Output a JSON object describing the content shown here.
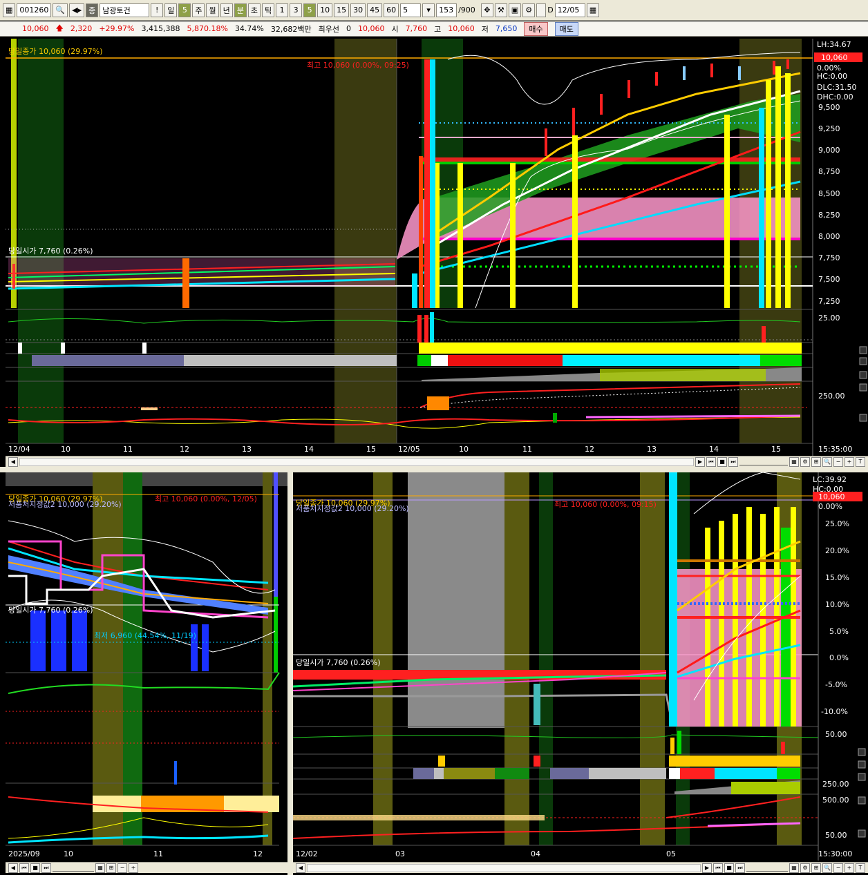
{
  "toolbar": {
    "code": "001260",
    "name": "남광토건",
    "name_badge": "종",
    "period_labels": [
      "일",
      "5",
      "주",
      "월",
      "년",
      "분",
      "초",
      "틱"
    ],
    "interval_labels": [
      "1",
      "3",
      "5",
      "10",
      "15",
      "30",
      "45",
      "60",
      "5"
    ],
    "count": "153",
    "count_total": "/900",
    "d_label": "D",
    "date": "12/05"
  },
  "infobar": {
    "price": "10,060",
    "change": "2,320",
    "change_pct": "+29.97%",
    "volume": "3,415,388",
    "volume_pct": "5,870.18%",
    "turnover_pct": "34.74%",
    "amount": "32,682백만",
    "best_label": "최우선",
    "best_value": "0",
    "best_price": "10,060",
    "open_label": "시",
    "open": "7,760",
    "high_label": "고",
    "high": "10,060",
    "low_label": "저",
    "low": "7,650",
    "buy_label": "매수",
    "sell_label": "매도"
  },
  "top_chart": {
    "close_label": "당일종가 10,060 (29.97%)",
    "high_label": "최고 10,060 (0.00%, 09:25)",
    "open_label": "당일시가 7,760 (0.26%)",
    "right_labels": [
      "LH:34.67",
      "10,060",
      "0.00%",
      "HC:0.00",
      "DLC:31.50",
      "DHC:0.00"
    ],
    "price_ticks": [
      "9,500",
      "9,250",
      "9,000",
      "8,750",
      "8,500",
      "8,250",
      "8,000",
      "7,750",
      "7,500",
      "7,250"
    ],
    "osc_tick": "25.00",
    "vol_tick": "250.00",
    "dates": [
      "12/04",
      "10",
      "11",
      "12",
      "13",
      "14",
      "15",
      "12/05",
      "10",
      "11",
      "12",
      "13",
      "14",
      "15"
    ],
    "time": "15:35:00"
  },
  "bottom_left_chart": {
    "close_label": "당일종가 10,060 (29.97%)",
    "high_label": "최고 10,060 (0.00%, 12/05)",
    "theory_label": "저품처지정값2 10,000 (29.20%)",
    "open_label": "당일시가 7,760 (0.26%)",
    "low_label": "최저 6,960 (44.54%, 11/19)",
    "dates": [
      "2025/09",
      "10",
      "11",
      "12"
    ]
  },
  "bottom_right_chart": {
    "close_label": "당일종가 10,060 (29.97%)",
    "theory_label": "저품처지정값2 10,000 (29.20%)",
    "high_label": "최고 10,060 (0.00%, 09:15)",
    "open_label": "당일시가 7,760 (0.26%)",
    "right_labels": [
      "LC:39.92",
      "HC:0.00",
      "10,060",
      "0.00%"
    ],
    "pct_ticks": [
      "25.0%",
      "20.0%",
      "15.0%",
      "10.0%",
      "5.0%",
      "0.0%",
      "-5.0%",
      "-10.0%"
    ],
    "osc_ticks": [
      "50.00",
      "250.00",
      "500.00",
      "50.00"
    ],
    "dates": [
      "12/02",
      "03",
      "04",
      "05"
    ],
    "time": "15:30:00"
  },
  "colors": {
    "up": "#e00000",
    "down": "#0030c0",
    "cyan": "#00e5ff",
    "yellow": "#ffff00",
    "pink": "#ff99cc",
    "green": "#00c000",
    "olive": "#5a5a10"
  }
}
